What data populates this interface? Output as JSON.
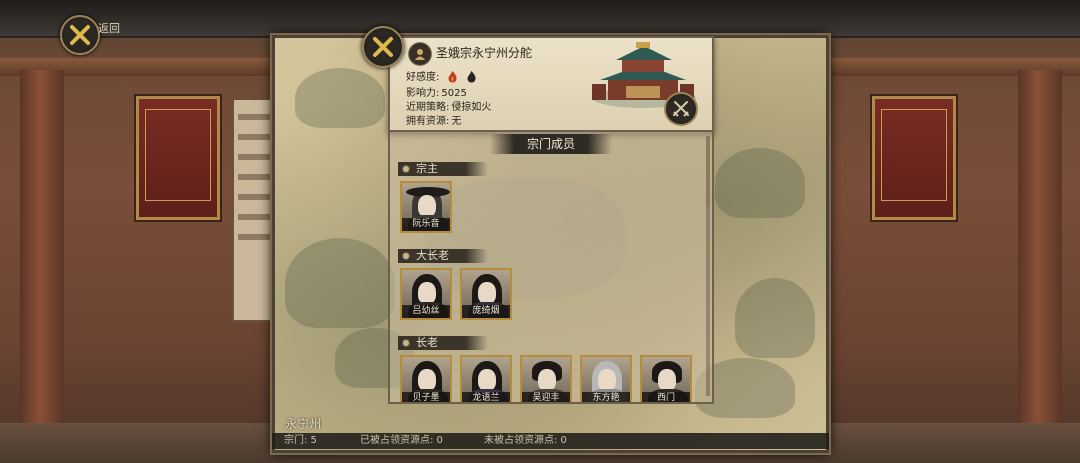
{
  "back": {
    "label": "返回"
  },
  "sect": {
    "name": "圣娥宗永宁州分舵",
    "favor_label": "好感度:",
    "influence_label": "影响力:",
    "influence_value": "5025",
    "strategy_label": "近期策略:",
    "strategy_value": "侵掠如火",
    "resources_label": "拥有资源:",
    "resources_value": "无"
  },
  "members_title": "宗门成员",
  "ranks": [
    {
      "title": "宗主",
      "members": [
        "阮乐音"
      ]
    },
    {
      "title": "大长老",
      "members": [
        "吕幼丝",
        "庞绮烟"
      ]
    },
    {
      "title": "长老",
      "members": [
        "贝子墨",
        "龙语兰",
        "吴迎丰",
        "东方艳",
        "西门"
      ]
    }
  ],
  "map": {
    "region_name": "永宁州"
  },
  "status": {
    "sects": "宗门: 5",
    "occupied": "已被占领资源点: 0",
    "unoccupied": "未被占领资源点: 0"
  },
  "colors": {
    "card_border": "#b58c3c",
    "panel_bg": "#ece2c9",
    "accent_gold": "#9a8256"
  }
}
